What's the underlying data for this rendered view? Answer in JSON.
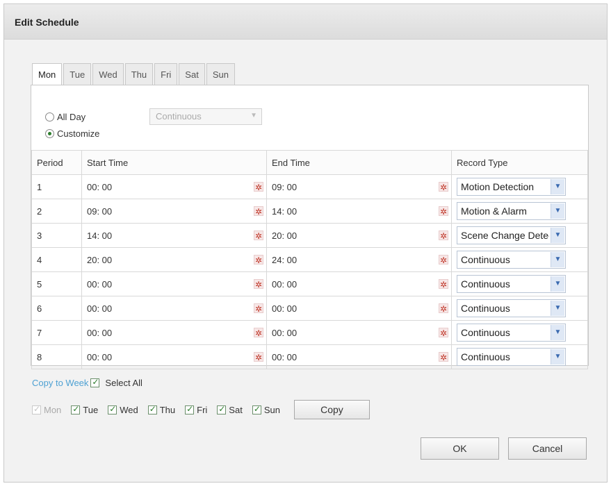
{
  "dialog": {
    "title": "Edit Schedule"
  },
  "tabs": [
    {
      "label": "Mon",
      "active": true
    },
    {
      "label": "Tue"
    },
    {
      "label": "Wed"
    },
    {
      "label": "Thu"
    },
    {
      "label": "Fri"
    },
    {
      "label": "Sat"
    },
    {
      "label": "Sun"
    }
  ],
  "mode": {
    "all_day_label": "All Day",
    "customize_label": "Customize",
    "selected": "Customize",
    "all_day_select_value": "Continuous"
  },
  "table": {
    "headers": {
      "period": "Period",
      "start": "Start Time",
      "end": "End Time",
      "record_type": "Record Type"
    },
    "rows": [
      {
        "period": "1",
        "start": "00: 00",
        "end": "09: 00",
        "type": "Motion Detection"
      },
      {
        "period": "2",
        "start": "09: 00",
        "end": "14: 00",
        "type": "Motion & Alarm"
      },
      {
        "period": "3",
        "start": "14: 00",
        "end": "20: 00",
        "type": "Scene Change Detection"
      },
      {
        "period": "4",
        "start": "20: 00",
        "end": "24: 00",
        "type": "Continuous"
      },
      {
        "period": "5",
        "start": "00: 00",
        "end": "00: 00",
        "type": "Continuous"
      },
      {
        "period": "6",
        "start": "00: 00",
        "end": "00: 00",
        "type": "Continuous"
      },
      {
        "period": "7",
        "start": "00: 00",
        "end": "00: 00",
        "type": "Continuous"
      },
      {
        "period": "8",
        "start": "00: 00",
        "end": "00: 00",
        "type": "Continuous"
      }
    ]
  },
  "copy": {
    "copy_to_week": "Copy to Week",
    "select_all": "Select All",
    "days": [
      {
        "label": "Mon",
        "checked": true,
        "disabled": true
      },
      {
        "label": "Tue",
        "checked": true
      },
      {
        "label": "Wed",
        "checked": true
      },
      {
        "label": "Thu",
        "checked": true
      },
      {
        "label": "Fri",
        "checked": true
      },
      {
        "label": "Sat",
        "checked": true
      },
      {
        "label": "Sun",
        "checked": true
      }
    ],
    "copy_button": "Copy"
  },
  "buttons": {
    "ok": "OK",
    "cancel": "Cancel"
  },
  "icons": {
    "time_picker": "clock-icon",
    "dropdown": "chevron-down-icon"
  },
  "colors": {
    "accent_link": "#4ea1d3",
    "check_green": "#2c7d2c"
  }
}
